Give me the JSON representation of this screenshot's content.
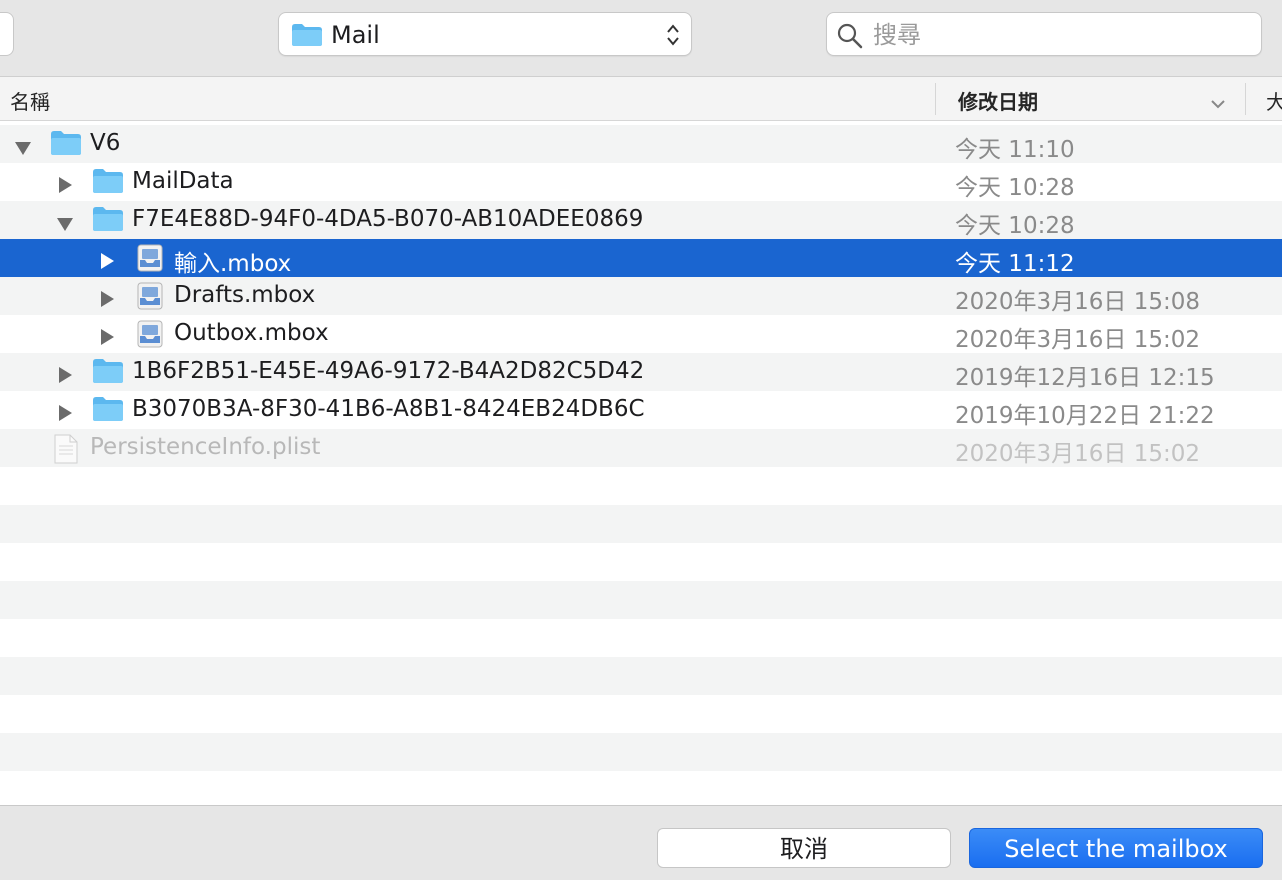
{
  "toolbar": {
    "location_label": "Mail",
    "search_placeholder": "搜尋"
  },
  "columns": {
    "name": "名稱",
    "date_modified": "修改日期",
    "size": "大"
  },
  "files": [
    {
      "name": "V6",
      "date": "今天 11:10",
      "kind": "folder",
      "expanded": true
    },
    {
      "name": "MailData",
      "date": "今天 10:28",
      "kind": "folder",
      "expanded": false
    },
    {
      "name": "F7E4E88D-94F0-4DA5-B070-AB10ADEE0869",
      "date": "今天 10:28",
      "kind": "folder",
      "expanded": true
    },
    {
      "name": "輸入.mbox",
      "date": "今天 11:12",
      "kind": "mbox",
      "expanded": false,
      "selected": true
    },
    {
      "name": "Drafts.mbox",
      "date": "2020年3月16日 15:08",
      "kind": "mbox",
      "expanded": false
    },
    {
      "name": "Outbox.mbox",
      "date": "2020年3月16日 15:02",
      "kind": "mbox",
      "expanded": false
    },
    {
      "name": "1B6F2B51-E45E-49A6-9172-B4A2D82C5D42",
      "date": "2019年12月16日 12:15",
      "kind": "folder",
      "expanded": false
    },
    {
      "name": "B3070B3A-8F30-41B6-A8B1-8424EB24DB6C",
      "date": "2019年10月22日 21:22",
      "kind": "folder",
      "expanded": false
    },
    {
      "name": "PersistenceInfo.plist",
      "date": "2020年3月16日 15:02",
      "kind": "plist",
      "disabled": true
    }
  ],
  "buttons": {
    "cancel": "取消",
    "confirm": "Select the mailbox"
  },
  "colors": {
    "selection": "#1a65d0",
    "folder": "#6cc4f5",
    "primary_button": "#1a6ef0"
  }
}
